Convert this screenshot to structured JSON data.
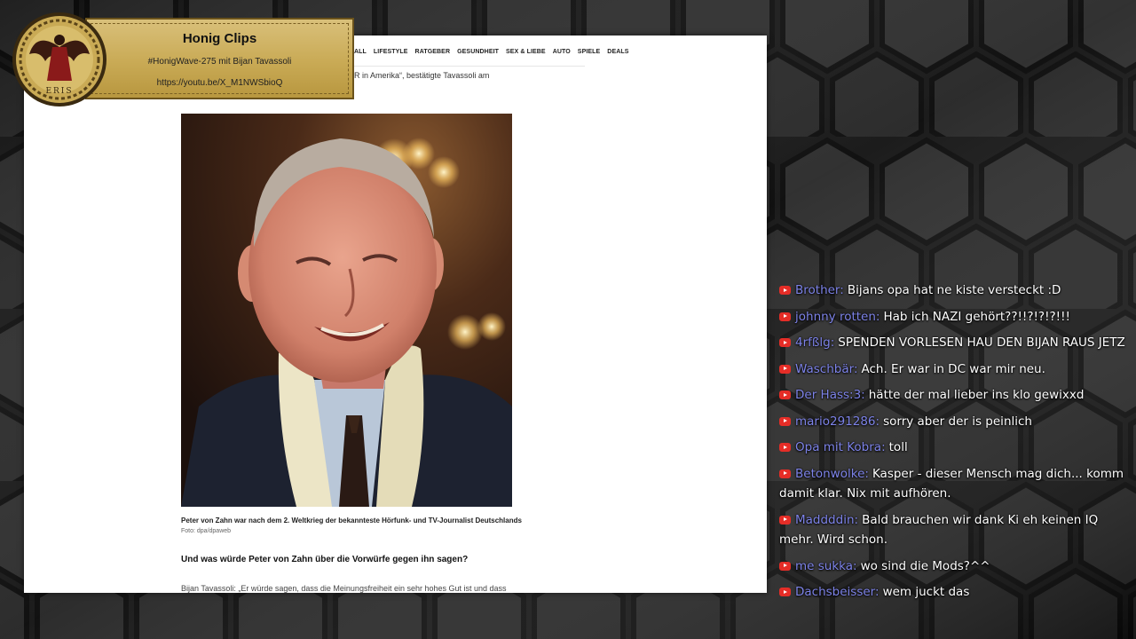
{
  "banner": {
    "title": "Honig Clips",
    "subtitle": "#HonigWave-275 mit Bijan Tavassoli",
    "url": "https://youtu.be/X_M1NWSbioQ",
    "logo_text": "ERIS"
  },
  "article": {
    "nav": [
      "ALL",
      "LIFESTYLE",
      "RATGEBER",
      "GESUNDHEIT",
      "SEX & LIEBE",
      "AUTO",
      "SPIELE",
      "DEALS"
    ],
    "snippet_top": "R in Amerika“, bestätigte Tavassoli am",
    "photo_alt": "Peter von Zahn portrait",
    "caption": "Peter von Zahn war nach dem 2. Weltkrieg der bekannteste Hörfunk- und TV-Journalist Deutschlands",
    "credit": "Foto: dpa/dpaweb",
    "question": "Und was würde Peter von Zahn über die Vorwürfe gegen ihn sagen?",
    "answer": "Bijan Tavassoli: „Er würde sagen, dass die Meinungsfreiheit ein sehr hohes Gut ist und dass"
  },
  "chat": {
    "messages": [
      {
        "author": "Brother",
        "text": "Bijans opa hat ne kiste versteckt :D"
      },
      {
        "author": "johnny rotten",
        "text": "Hab ich NAZI gehört??!!?!?!?!!!"
      },
      {
        "author": "4rfßlg",
        "text": "SPENDEN VORLESEN HAU DEN BIJAN RAUS JETZ"
      },
      {
        "author": "Waschbär",
        "text": "Ach. Er war in DC war mir neu."
      },
      {
        "author": "Der Hass:3",
        "text": "hätte der mal lieber ins klo gewixxd"
      },
      {
        "author": "mario291286",
        "text": "sorry aber der is peinlich"
      },
      {
        "author": "Opa mit Kobra",
        "text": "toll"
      },
      {
        "author": "Betonwolke",
        "text": "Kasper - dieser Mensch mag dich... komm damit klar. Nix mit aufhören."
      },
      {
        "author": "Maddddin",
        "text": "Bald brauchen wir dank Ki eh keinen IQ mehr. Wird schon."
      },
      {
        "author": "me sukka",
        "text": "wo sind die Mods?^^"
      },
      {
        "author": "Dachsbeisser",
        "text": "wem juckt das"
      }
    ]
  },
  "colors": {
    "author": "#7d83e8",
    "youtube_red": "#e52d27",
    "banner_gold": "#c9aa55"
  }
}
